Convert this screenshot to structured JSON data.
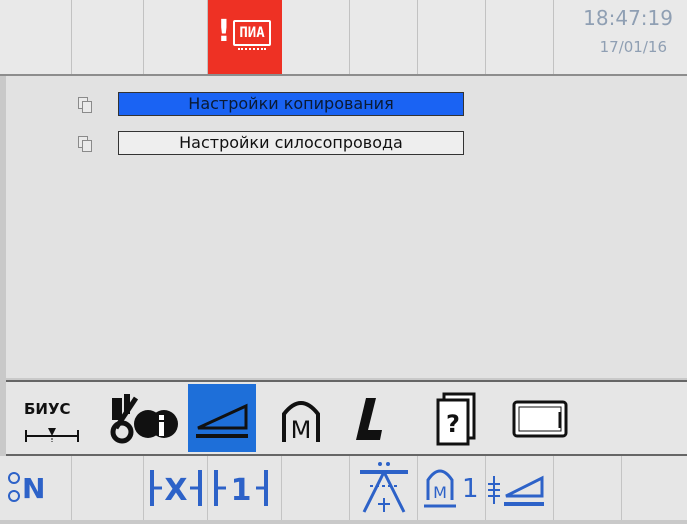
{
  "status_bar": {
    "alarm_label": "ПИА",
    "time": "18:47:19",
    "date": "17/01/16",
    "alarm_color": "#ee3124",
    "clock_color": "#8f9fb3"
  },
  "menu": {
    "items": [
      {
        "label": "Настройки копирования",
        "selected": true,
        "icon": "document-stack-icon"
      },
      {
        "label": "Настройки силосопровода",
        "selected": false,
        "icon": "document-stack-icon"
      }
    ],
    "selected_color": "#1a63f3"
  },
  "toolbar": {
    "items": [
      {
        "name": "biys-header-height-button",
        "label": "БИУС",
        "icon": "height-scale-icon"
      },
      {
        "name": "machine-info-button",
        "icon": "harvester-info-icon"
      },
      {
        "name": "header-tilt-button",
        "icon": "tilt-wedge-icon",
        "active": true
      },
      {
        "name": "manual-mode-button",
        "icon": "m-arch-icon"
      },
      {
        "name": "l-mode-button",
        "icon": "l-letter-icon"
      },
      {
        "name": "help-manual-button",
        "icon": "help-book-icon"
      },
      {
        "name": "display-settings-button",
        "icon": "screen-icon"
      }
    ],
    "active_color": "#1e6fd9"
  },
  "bottom_bar": {
    "items": [
      {
        "name": "neutral-indicator",
        "label": "N"
      },
      {
        "name": "copy-center-button",
        "label": "X"
      },
      {
        "name": "copy-one-button",
        "label": "1"
      },
      {
        "name": "auger-spread-button",
        "icon": "spreader-icon"
      },
      {
        "name": "manual-one-button",
        "label": "1",
        "icon": "m-arch-icon"
      },
      {
        "name": "tilt-set-button",
        "icon": "tilt-adjust-icon"
      }
    ],
    "glyph_color": "#2d62c8"
  }
}
